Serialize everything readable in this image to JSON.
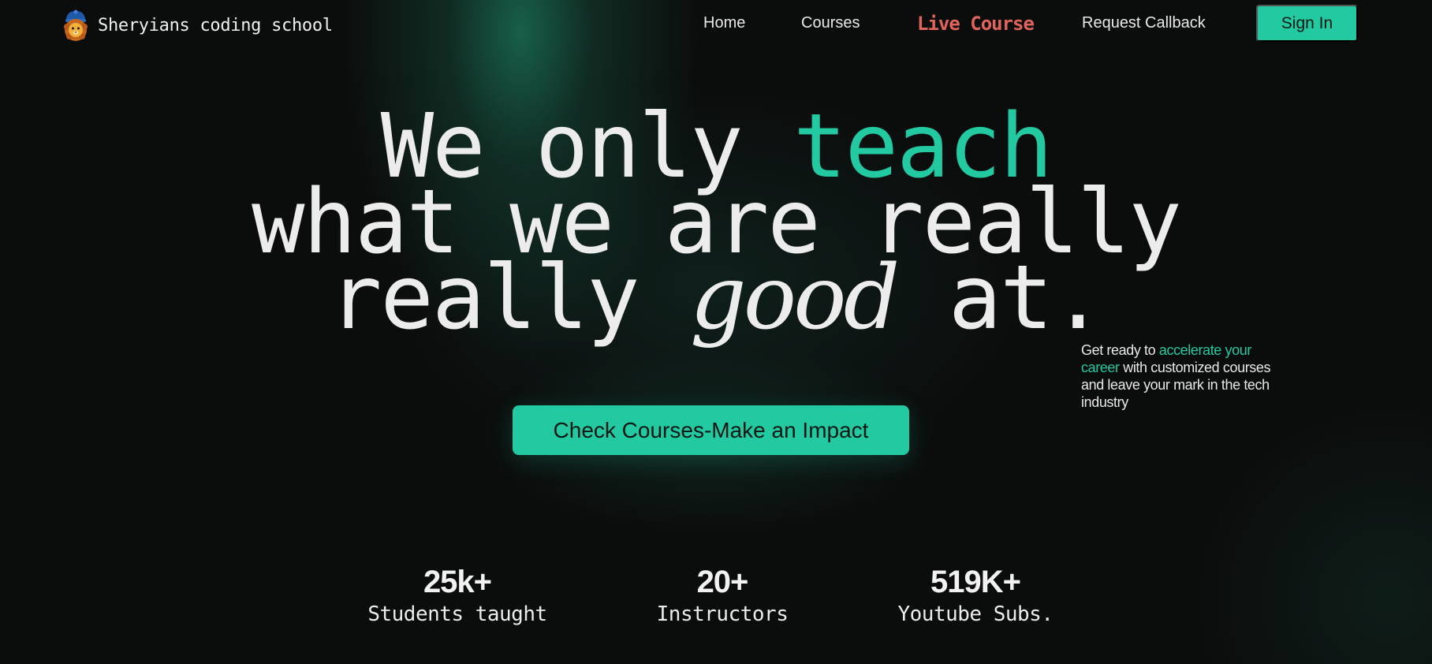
{
  "brand": {
    "name": "Sheryians coding school",
    "icon": "lion-mascot-icon"
  },
  "nav": {
    "home": "Home",
    "courses": "Courses",
    "live_course": "Live Course",
    "request_callback": "Request Callback",
    "sign_in": "Sign In"
  },
  "hero": {
    "line1_a": "We only ",
    "line1_b": "teach",
    "line2": "what we are really",
    "line3_a": "really ",
    "line3_b": "good",
    "line3_c": " at."
  },
  "cta": {
    "label": "Check Courses-Make an Impact"
  },
  "tagline": {
    "part1": "Get ready to ",
    "accent": "accelerate your career",
    "part2": " with customized courses and leave your mark in the tech industry"
  },
  "stats": [
    {
      "value": "25k+",
      "label": "Students taught"
    },
    {
      "value": "20+",
      "label": "Instructors"
    },
    {
      "value": "519K+",
      "label": "Youtube Subs."
    }
  ],
  "colors": {
    "accent": "#22c9a1",
    "live": "#e0645a",
    "background": "#0b0c0c"
  }
}
